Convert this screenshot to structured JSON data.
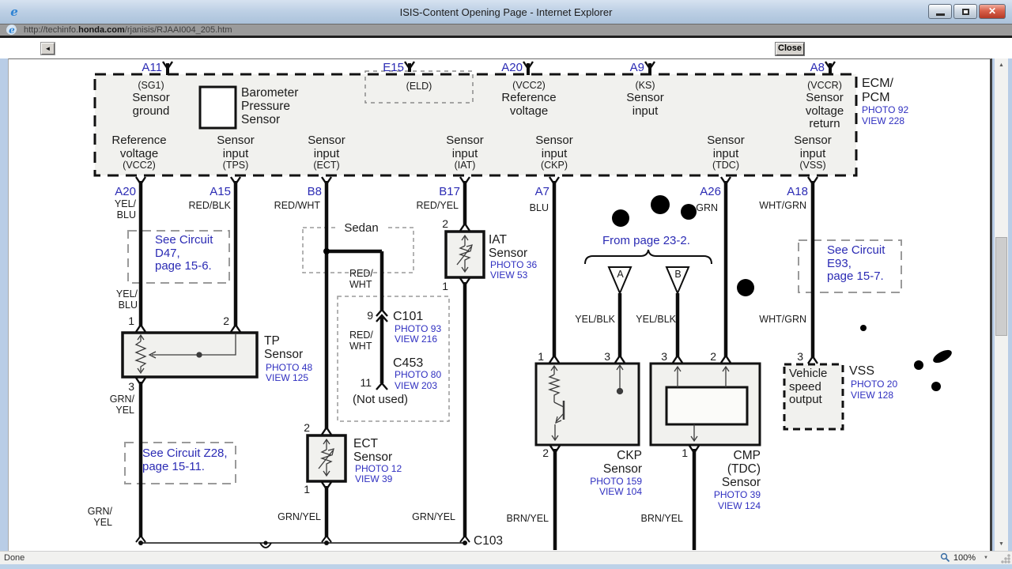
{
  "window": {
    "title": "ISIS-Content Opening Page - Internet Explorer",
    "url_prefix": "http://techinfo.",
    "url_domain": "honda.com",
    "url_path": "/rjanisis/RJAAI004_205.htm",
    "toolbar": {
      "close_label": "Close"
    },
    "status": {
      "left": "Done",
      "zoom": "100%"
    },
    "glyphs": {
      "ie": "e",
      "back": "◄",
      "close_x": "✕",
      "scroll_up": "▲",
      "scroll_down": "▼",
      "caret": "▼"
    }
  },
  "ecm": {
    "name": "ECM/\nPCM",
    "photo": "PHOTO 92",
    "view": "VIEW 228",
    "barometer_label": "Barometer\nPressure\nSensor",
    "top_pins": [
      {
        "id": "A11",
        "sub": "(SG1)",
        "label": "Sensor\nground"
      },
      {
        "id": "E15",
        "sub": "(ELD)",
        "label": ""
      },
      {
        "id": "A20",
        "sub": "(VCC2)",
        "label": "Reference\nvoltage"
      },
      {
        "id": "A9",
        "sub": "(KS)",
        "label": "Sensor\ninput"
      },
      {
        "id": "A8",
        "sub": "(VCCR)",
        "label": "Sensor\nvoltage\nreturn"
      }
    ],
    "bottom_labels": [
      {
        "label": "Reference\nvoltage",
        "sub": "(VCC2)"
      },
      {
        "label": "Sensor\ninput",
        "sub": "(TPS)"
      },
      {
        "label": "Sensor\ninput",
        "sub": "(ECT)"
      },
      {
        "label": "Sensor\ninput",
        "sub": "(IAT)"
      },
      {
        "label": "Sensor\ninput",
        "sub": "(CKP)"
      },
      {
        "label": "Sensor\ninput",
        "sub": "(TDC)"
      },
      {
        "label": "Sensor\ninput",
        "sub": "(VSS)"
      }
    ],
    "bottom_pins": [
      {
        "id": "A20",
        "wire": "YEL/\nBLU"
      },
      {
        "id": "A15",
        "wire": "RED/BLK"
      },
      {
        "id": "B8",
        "wire": "RED/WHT"
      },
      {
        "id": "B17",
        "wire": "RED/YEL"
      },
      {
        "id": "A7",
        "wire": "BLU"
      },
      {
        "id": "A26",
        "wire": "GRN"
      },
      {
        "id": "A18",
        "wire": "WHT/GRN"
      }
    ]
  },
  "notes": {
    "d47": "See Circuit\nD47,\npage 15-6.",
    "z28": "See Circuit Z28,\npage 15-11.",
    "e93": "See Circuit\nE93,\npage 15-7.",
    "from_page": "From page 23-2.",
    "sedan": "Sedan",
    "not_used": "(Not used)"
  },
  "sensors": {
    "tp": {
      "name": "TP\nSensor",
      "photo": "PHOTO 48",
      "view": "VIEW 125",
      "pin1": "1",
      "pin2": "2",
      "pin3": "3"
    },
    "ect": {
      "name": "ECT\nSensor",
      "photo": "PHOTO 12",
      "view": "VIEW 39",
      "pin2": "2",
      "pin1": "1"
    },
    "iat": {
      "name": "IAT\nSensor",
      "photo": "PHOTO 36",
      "view": "VIEW 53",
      "pin2": "2",
      "pin1": "1"
    },
    "ckp": {
      "name": "CKP\nSensor",
      "photo": "PHOTO 159",
      "view": "VIEW 104",
      "pin1": "1",
      "pin3": "3",
      "pin2": "2"
    },
    "cmp": {
      "name": "CMP\n(TDC)\nSensor",
      "photo": "PHOTO 39",
      "view": "VIEW 124",
      "pin3": "3",
      "pin2": "2",
      "pin1": "1"
    },
    "vss": {
      "box": "Vehicle\nspeed\noutput",
      "name": "VSS",
      "photo": "PHOTO 20",
      "view": "VIEW 128",
      "pin3": "3"
    }
  },
  "connectors": {
    "c101": {
      "id": "C101",
      "photo": "PHOTO 93",
      "view": "VIEW 216",
      "pin": "9"
    },
    "c453": {
      "id": "C453",
      "photo": "PHOTO 80",
      "view": "VIEW 203",
      "pin": "11"
    },
    "c103": {
      "id": "C103"
    }
  },
  "wires": {
    "yel_blu": "YEL/\nBLU",
    "grn_yel_wrap": "GRN/\nYEL",
    "red_wht_wrap": "RED/\nWHT",
    "grn_yel": "GRN/YEL",
    "brn_yel": "BRN/YEL",
    "yel_blk": "YEL/BLK",
    "wht_grn": "WHT/GRN",
    "tri_a": "A",
    "tri_b": "B"
  },
  "colors": {
    "link_blue": "#2b2bb4",
    "box_fill": "#f1f1ee",
    "wire_black": "#0d0d0d"
  }
}
